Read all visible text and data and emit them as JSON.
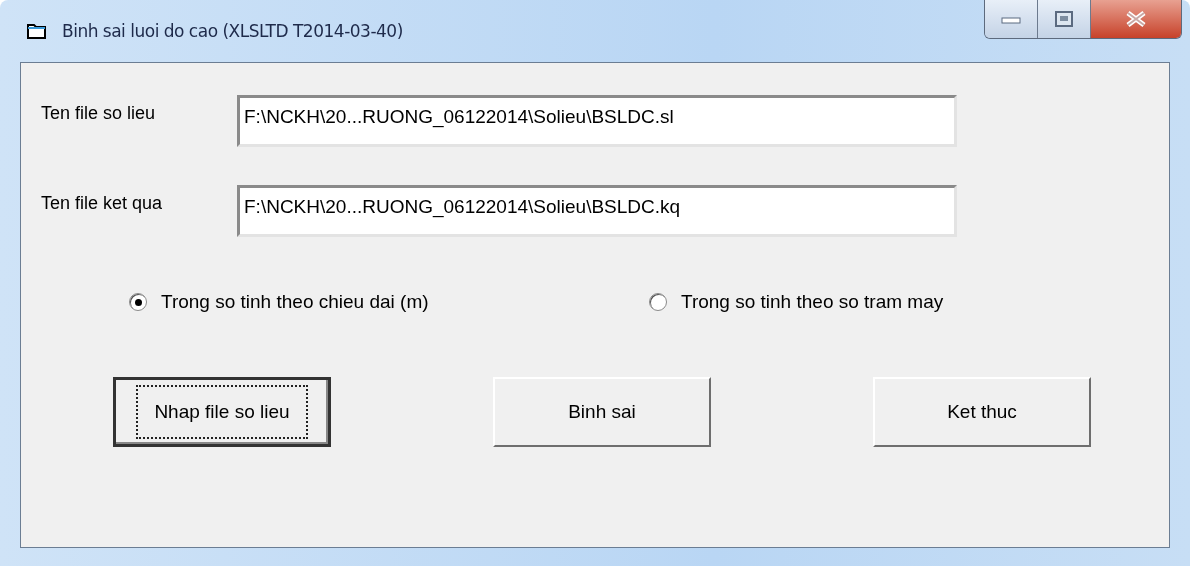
{
  "window": {
    "title": "Binh sai luoi do cao (XLSLTD T2014-03-40)"
  },
  "fields": [
    {
      "label": "Ten file so lieu",
      "value": "F:\\NCKH\\20...RUONG_06122014\\Solieu\\BSLDC.sl"
    },
    {
      "label": "Ten file ket qua",
      "value": "F:\\NCKH\\20...RUONG_06122014\\Solieu\\BSLDC.kq"
    }
  ],
  "options": [
    {
      "label": "Trong so tinh theo chieu dai (m)",
      "selected": true
    },
    {
      "label": "Trong so tinh theo so tram may",
      "selected": false
    }
  ],
  "buttons": [
    {
      "label": "Nhap file so lieu",
      "focused": true
    },
    {
      "label": "Binh sai",
      "focused": false
    },
    {
      "label": "Ket thuc",
      "focused": false
    }
  ]
}
